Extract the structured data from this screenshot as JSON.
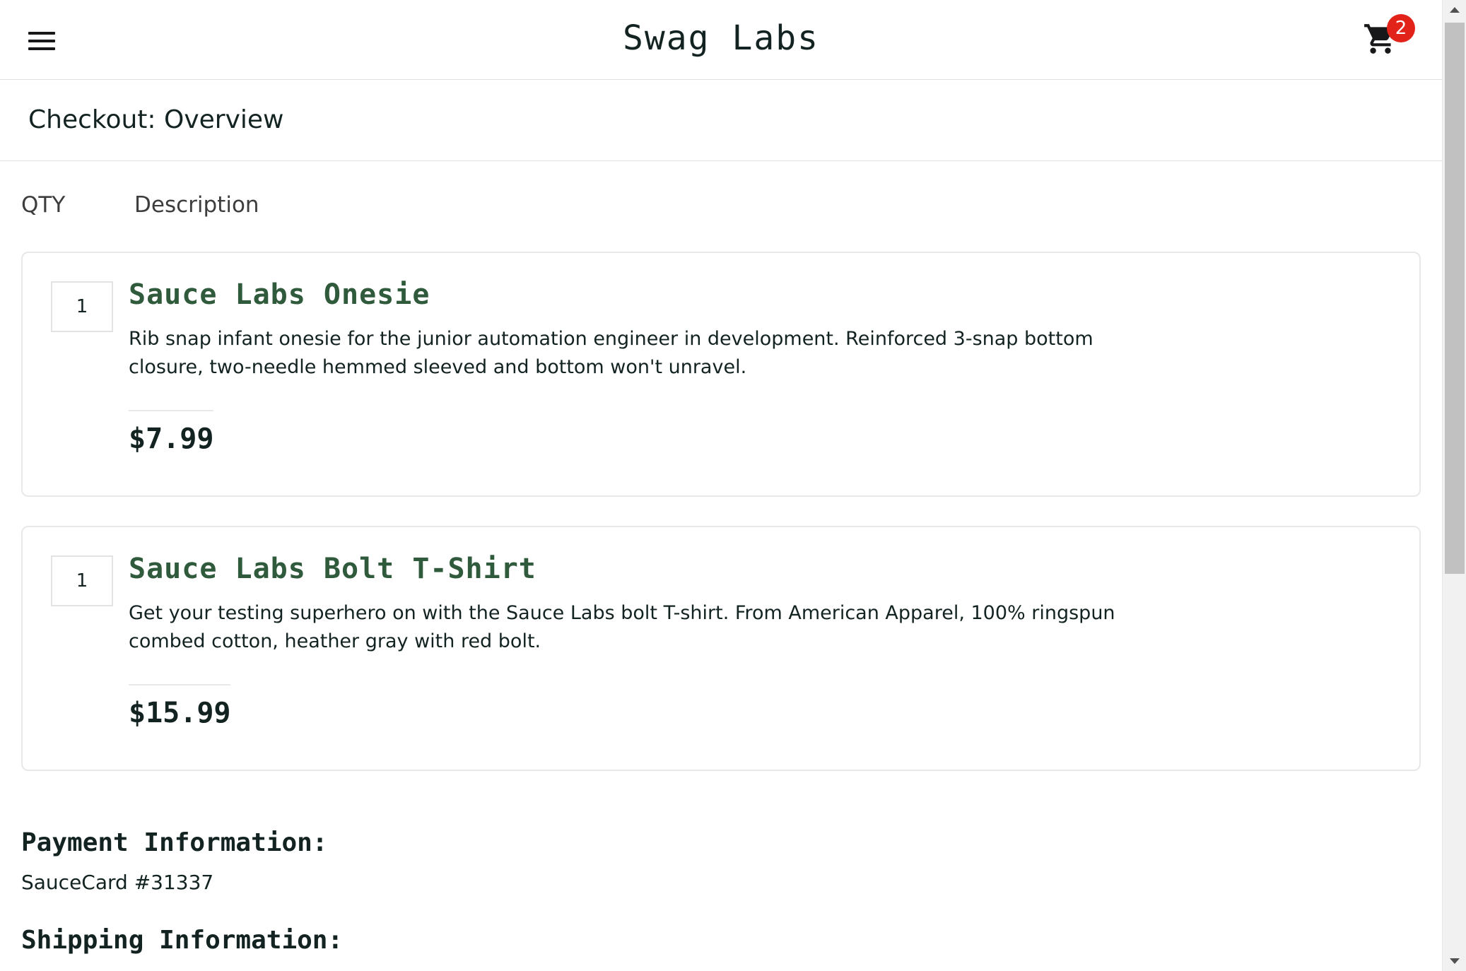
{
  "header": {
    "app_title": "Swag Labs",
    "menu_icon": "hamburger-menu-icon",
    "cart_icon": "shopping-cart-icon",
    "cart_badge_count": "2",
    "badge_color": "#e2231a"
  },
  "page": {
    "title": "Checkout: Overview"
  },
  "columns": {
    "qty": "QTY",
    "description": "Description"
  },
  "items": [
    {
      "qty": "1",
      "name": "Sauce Labs Onesie",
      "description": "Rib snap infant onesie for the junior automation engineer in development. Reinforced 3-snap bottom closure, two-needle hemmed sleeved and bottom won't unravel.",
      "price": "$7.99"
    },
    {
      "qty": "1",
      "name": "Sauce Labs Bolt T-Shirt",
      "description": "Get your testing superhero on with the Sauce Labs bolt T-shirt. From American Apparel, 100% ringspun combed cotton, heather gray with red bolt.",
      "price": "$15.99"
    }
  ],
  "summary": {
    "payment_label": "Payment Information:",
    "payment_value": "SauceCard #31337",
    "shipping_label": "Shipping Information:"
  },
  "colors": {
    "item_name": "#2f5a3b",
    "text": "#132322"
  }
}
